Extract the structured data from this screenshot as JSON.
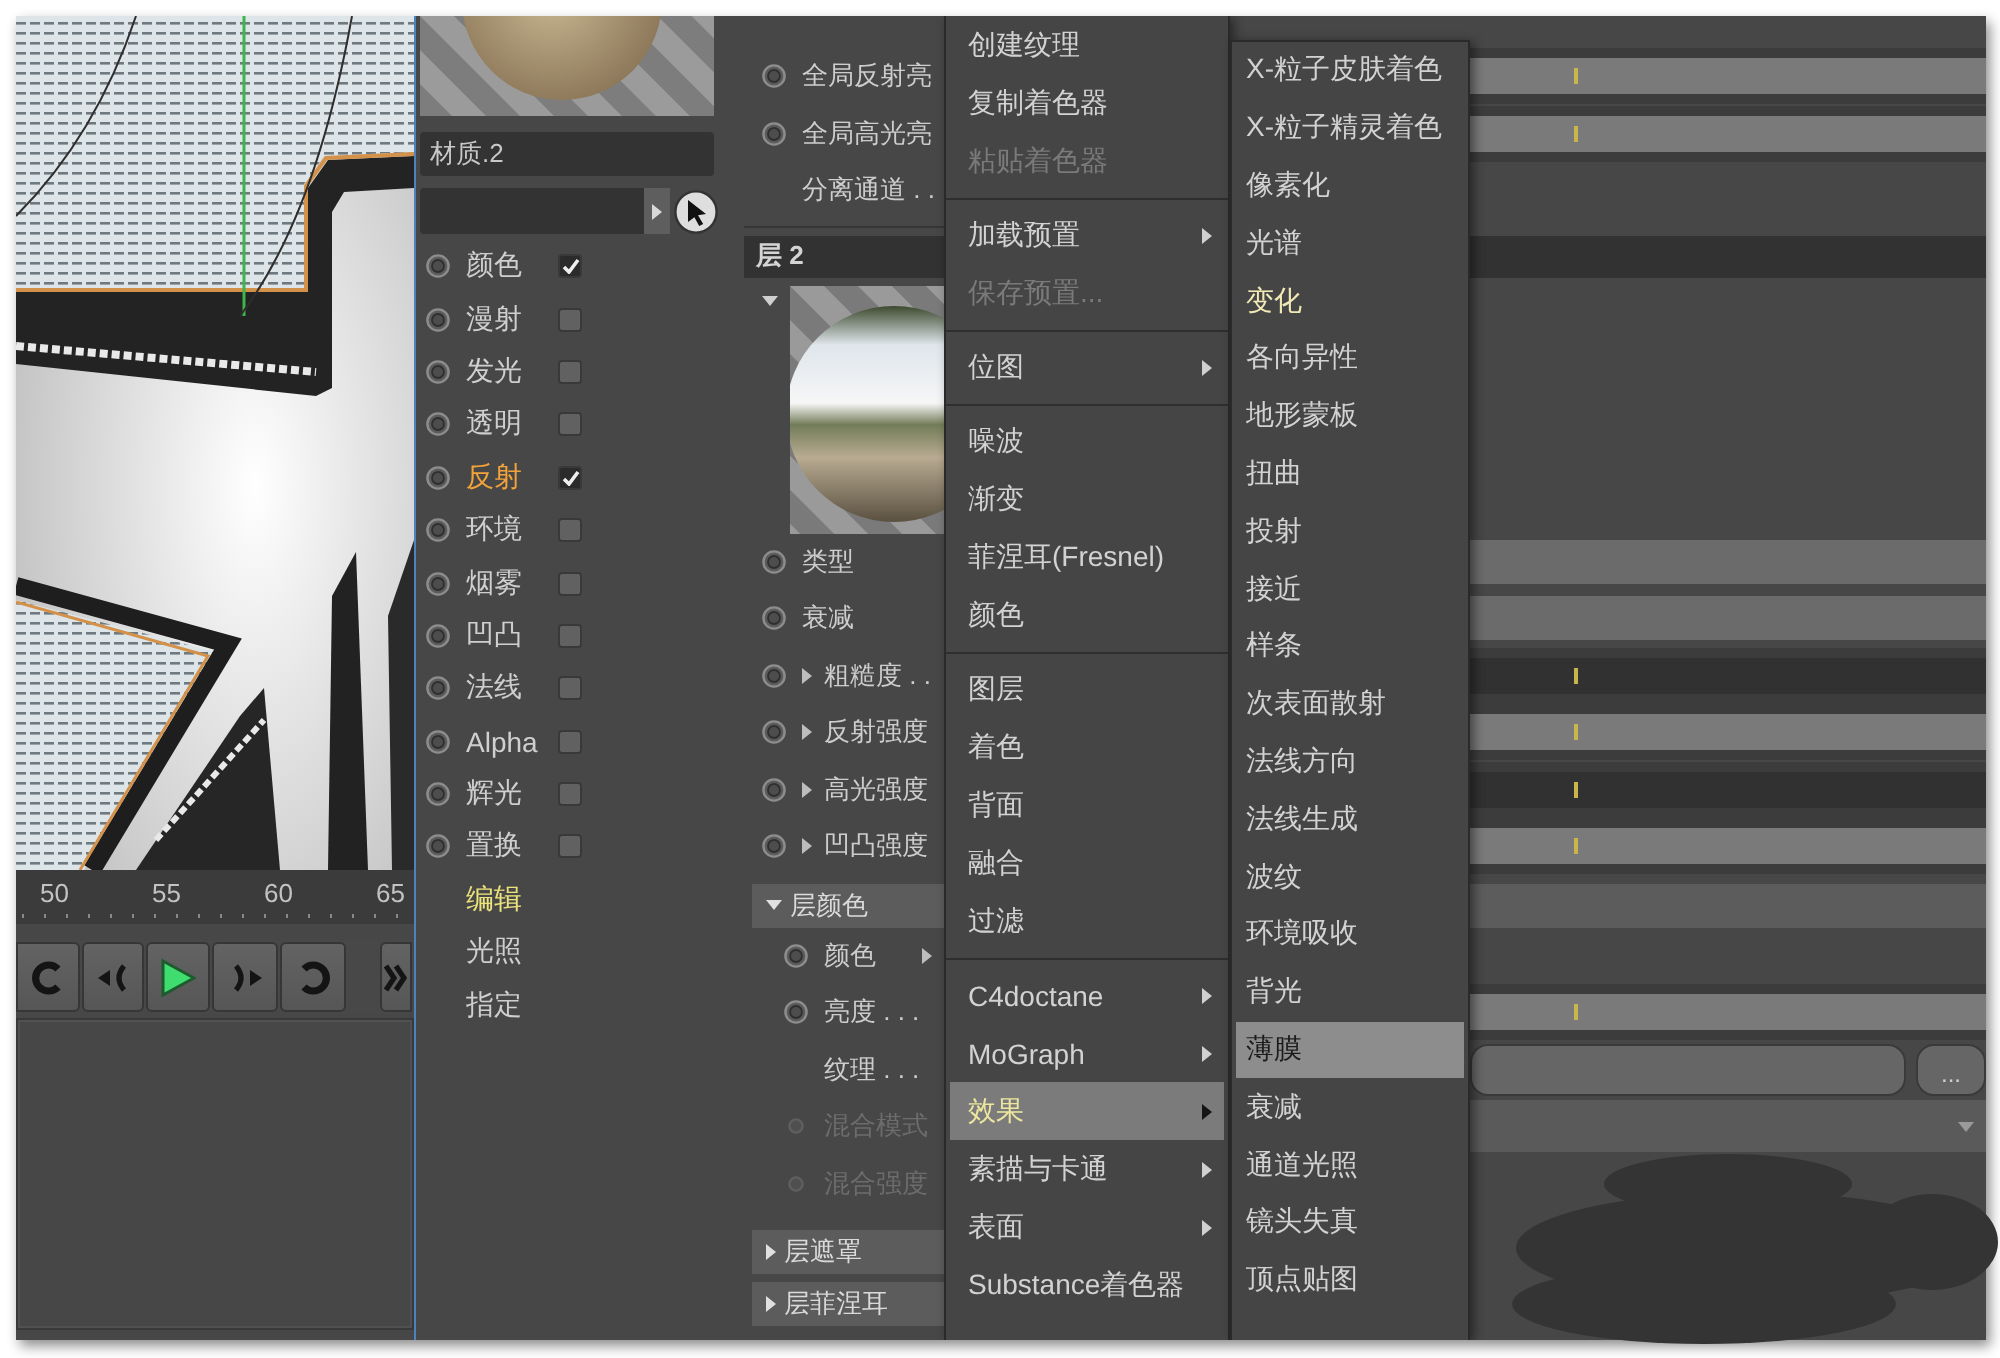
{
  "timeline": {
    "ticks": [
      "50",
      "55",
      "60",
      "65"
    ]
  },
  "material": {
    "name": "材质.2",
    "channels": [
      {
        "label": "颜色",
        "checked": true,
        "selected": false
      },
      {
        "label": "漫射",
        "checked": false,
        "selected": false
      },
      {
        "label": "发光",
        "checked": false,
        "selected": false
      },
      {
        "label": "透明",
        "checked": false,
        "selected": false
      },
      {
        "label": "反射",
        "checked": true,
        "selected": true
      },
      {
        "label": "环境",
        "checked": false,
        "selected": false
      },
      {
        "label": "烟雾",
        "checked": false,
        "selected": false
      },
      {
        "label": "凹凸",
        "checked": false,
        "selected": false
      },
      {
        "label": "法线",
        "checked": false,
        "selected": false
      },
      {
        "label": "Alpha",
        "checked": false,
        "selected": false
      },
      {
        "label": "辉光",
        "checked": false,
        "selected": false
      },
      {
        "label": "置换",
        "checked": false,
        "selected": false
      }
    ],
    "pages": [
      {
        "label": "编辑",
        "selected": true
      },
      {
        "label": "光照",
        "selected": false
      },
      {
        "label": "指定",
        "selected": false
      }
    ]
  },
  "attributes": {
    "rows": [
      {
        "kind": "lightbar",
        "ring": true,
        "label": "全局反射亮",
        "disabled": false
      },
      {
        "kind": "lightbar",
        "ring": true,
        "label": "全局高光亮",
        "disabled": false
      },
      {
        "kind": "plain",
        "ring": false,
        "label": "分离通道 . .",
        "disabled": false
      },
      {
        "kind": "layer",
        "label": "层 2"
      },
      {
        "kind": "preview",
        "expanded": true
      },
      {
        "kind": "greybar",
        "ring": true,
        "label": "类型",
        "disabled": false
      },
      {
        "kind": "greybar",
        "ring": true,
        "label": "衰减",
        "disabled": false
      },
      {
        "kind": "darkbar",
        "ring": true,
        "expanded": false,
        "label": "粗糙度 . .",
        "disabled": false
      },
      {
        "kind": "lightbar",
        "ring": true,
        "expanded": false,
        "label": "反射强度",
        "disabled": false
      },
      {
        "kind": "darkbar",
        "ring": true,
        "expanded": false,
        "label": "高光强度",
        "disabled": false
      },
      {
        "kind": "lightbar",
        "ring": true,
        "expanded": false,
        "label": "凹凸强度",
        "disabled": false
      },
      {
        "kind": "section",
        "label": "层颜色",
        "expanded": true,
        "children": [
          {
            "kind": "color",
            "ring": true,
            "expanded": false,
            "label": "颜色",
            "disabled": false
          },
          {
            "kind": "lightbar",
            "ring": true,
            "label": "亮度 . . .",
            "disabled": false
          },
          {
            "kind": "field",
            "ring": false,
            "label": "纹理 . . .",
            "disabled": false,
            "button": "..."
          },
          {
            "kind": "dropdown",
            "ring": true,
            "label": "混合模式",
            "disabled": true
          },
          {
            "kind": "plain",
            "ring": true,
            "label": "混合强度",
            "disabled": true
          }
        ]
      },
      {
        "kind": "section",
        "label": "层遮罩",
        "expanded": false
      },
      {
        "kind": "section",
        "label": "层菲涅耳",
        "expanded": false
      }
    ]
  },
  "context_menu": {
    "groups": [
      [
        {
          "label": "创建纹理",
          "submenu": false,
          "disabled": false,
          "selected": false
        },
        {
          "label": "复制着色器",
          "submenu": false,
          "disabled": false,
          "selected": false
        },
        {
          "label": "粘贴着色器",
          "submenu": false,
          "disabled": true,
          "selected": false
        }
      ],
      [
        {
          "label": "加载预置",
          "submenu": true,
          "disabled": false,
          "selected": false
        },
        {
          "label": "保存预置...",
          "submenu": false,
          "disabled": true,
          "selected": false
        }
      ],
      [
        {
          "label": "位图",
          "submenu": true,
          "disabled": false,
          "selected": false
        }
      ],
      [
        {
          "label": "噪波",
          "submenu": false,
          "disabled": false,
          "selected": false
        },
        {
          "label": "渐变",
          "submenu": false,
          "disabled": false,
          "selected": false
        },
        {
          "label": "菲涅耳(Fresnel)",
          "submenu": false,
          "disabled": false,
          "selected": false
        },
        {
          "label": "颜色",
          "submenu": false,
          "disabled": false,
          "selected": false
        }
      ],
      [
        {
          "label": "图层",
          "submenu": false,
          "disabled": false,
          "selected": false
        },
        {
          "label": "着色",
          "submenu": false,
          "disabled": false,
          "selected": false
        },
        {
          "label": "背面",
          "submenu": false,
          "disabled": false,
          "selected": false
        },
        {
          "label": "融合",
          "submenu": false,
          "disabled": false,
          "selected": false
        },
        {
          "label": "过滤",
          "submenu": false,
          "disabled": false,
          "selected": false
        }
      ],
      [
        {
          "label": "C4doctane",
          "submenu": true,
          "disabled": false,
          "selected": false
        },
        {
          "label": "MoGraph",
          "submenu": true,
          "disabled": false,
          "selected": false
        },
        {
          "label": "效果",
          "submenu": true,
          "disabled": false,
          "selected": true
        },
        {
          "label": "素描与卡通",
          "submenu": true,
          "disabled": false,
          "selected": false
        },
        {
          "label": "表面",
          "submenu": true,
          "disabled": false,
          "selected": false
        },
        {
          "label": "Substance着色器",
          "submenu": false,
          "disabled": false,
          "selected": false
        }
      ]
    ]
  },
  "submenu": {
    "items": [
      {
        "label": "X-粒子皮肤着色",
        "selected": false,
        "highlighted": false
      },
      {
        "label": "X-粒子精灵着色",
        "selected": false,
        "highlighted": false
      },
      {
        "label": "像素化",
        "selected": false,
        "highlighted": false
      },
      {
        "label": "光谱",
        "selected": false,
        "highlighted": false
      },
      {
        "label": "变化",
        "selected": false,
        "highlighted": true
      },
      {
        "label": "各向异性",
        "selected": false,
        "highlighted": false
      },
      {
        "label": "地形蒙板",
        "selected": false,
        "highlighted": false
      },
      {
        "label": "扭曲",
        "selected": false,
        "highlighted": false
      },
      {
        "label": "投射",
        "selected": false,
        "highlighted": false
      },
      {
        "label": "接近",
        "selected": false,
        "highlighted": false
      },
      {
        "label": "样条",
        "selected": false,
        "highlighted": false
      },
      {
        "label": "次表面散射",
        "selected": false,
        "highlighted": false
      },
      {
        "label": "法线方向",
        "selected": false,
        "highlighted": false
      },
      {
        "label": "法线生成",
        "selected": false,
        "highlighted": false
      },
      {
        "label": "波纹",
        "selected": false,
        "highlighted": false
      },
      {
        "label": "环境吸收",
        "selected": false,
        "highlighted": false
      },
      {
        "label": "背光",
        "selected": false,
        "highlighted": false
      },
      {
        "label": "薄膜",
        "selected": true,
        "highlighted": false
      },
      {
        "label": "衰减",
        "selected": false,
        "highlighted": false
      },
      {
        "label": "通道光照",
        "selected": false,
        "highlighted": false
      },
      {
        "label": "镜头失真",
        "selected": false,
        "highlighted": false
      },
      {
        "label": "顶点贴图",
        "selected": false,
        "highlighted": false
      }
    ]
  }
}
